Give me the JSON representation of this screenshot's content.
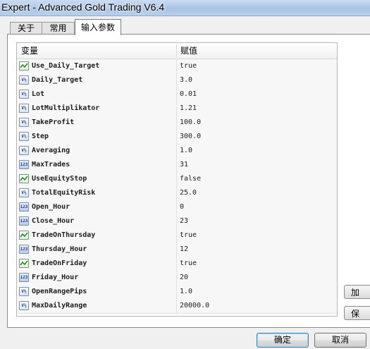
{
  "window": {
    "title": "Expert - Advanced Gold Trading V6.4"
  },
  "tabs": [
    {
      "label": "关于",
      "active": false
    },
    {
      "label": "常用",
      "active": false
    },
    {
      "label": "输入参数",
      "active": true
    }
  ],
  "grid": {
    "header_variable": "变量",
    "header_value": "赋值",
    "rows": [
      {
        "name": "Use_Daily_Target",
        "value": "true",
        "icon": "bool-icon"
      },
      {
        "name": "Daily_Target",
        "value": "3.0",
        "icon": "double-icon"
      },
      {
        "name": "Lot",
        "value": "0.01",
        "icon": "double-icon"
      },
      {
        "name": "LotMultiplikator",
        "value": "1.21",
        "icon": "double-icon"
      },
      {
        "name": "TakeProfit",
        "value": "100.0",
        "icon": "double-icon"
      },
      {
        "name": "Step",
        "value": "300.0",
        "icon": "double-icon"
      },
      {
        "name": "Averaging",
        "value": "1.0",
        "icon": "double-icon"
      },
      {
        "name": "MaxTrades",
        "value": "31",
        "icon": "int-icon"
      },
      {
        "name": "UseEquityStop",
        "value": "false",
        "icon": "bool-icon"
      },
      {
        "name": "TotalEquityRisk",
        "value": "25.0",
        "icon": "double-icon"
      },
      {
        "name": "Open_Hour",
        "value": "0",
        "icon": "int-icon"
      },
      {
        "name": "Close_Hour",
        "value": "23",
        "icon": "int-icon"
      },
      {
        "name": "TradeOnThursday",
        "value": "true",
        "icon": "bool-icon"
      },
      {
        "name": "Thursday_Hour",
        "value": "12",
        "icon": "int-icon"
      },
      {
        "name": "TradeOnFriday",
        "value": "true",
        "icon": "bool-icon"
      },
      {
        "name": "Friday_Hour",
        "value": "20",
        "icon": "int-icon"
      },
      {
        "name": "OpenRangePips",
        "value": "1.0",
        "icon": "double-icon"
      },
      {
        "name": "MaxDailyRange",
        "value": "20000.0",
        "icon": "double-icon"
      }
    ]
  },
  "side_buttons": {
    "load_label": "加",
    "save_label": "保"
  },
  "footer": {
    "ok_label": "确定",
    "cancel_label": "取消"
  }
}
